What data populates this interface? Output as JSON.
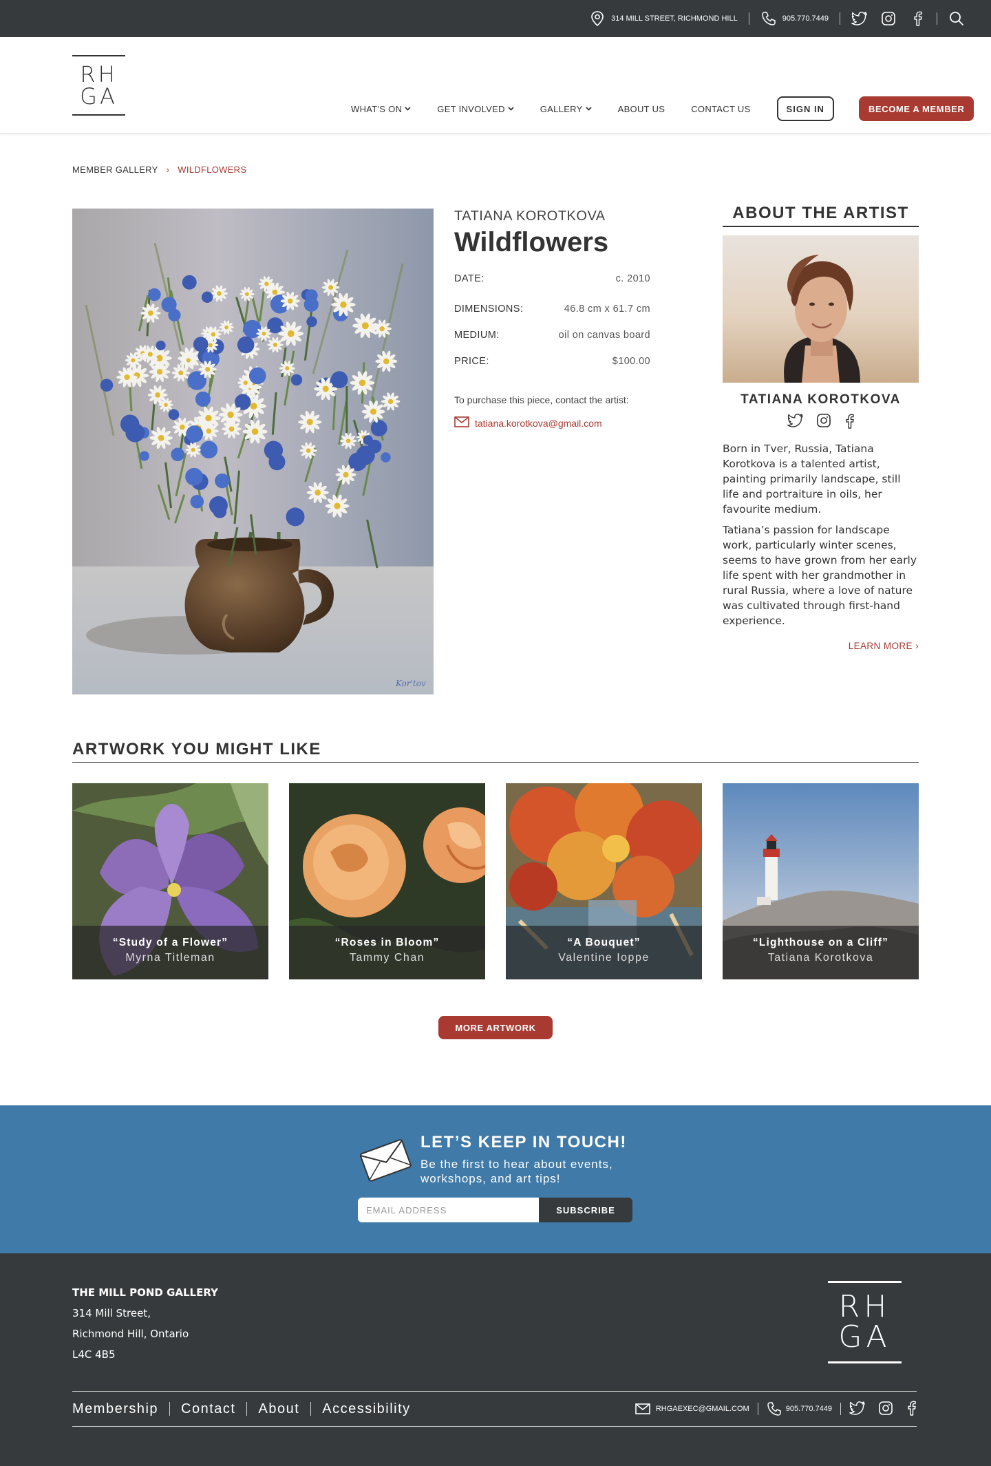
{
  "topbar": {
    "address": "314 MILL STREET, RICHMOND HILL",
    "phone": "905.770.7449"
  },
  "logo": {
    "line1": "RH",
    "line2": "GA"
  },
  "nav": {
    "items": [
      {
        "label": "WHAT'S ON",
        "dropdown": true
      },
      {
        "label": "GET INVOLVED",
        "dropdown": true
      },
      {
        "label": "GALLERY",
        "dropdown": true
      },
      {
        "label": "ABOUT US",
        "dropdown": false
      },
      {
        "label": "CONTACT US",
        "dropdown": false
      }
    ],
    "signin": "SIGN IN",
    "member": "BECOME A MEMBER"
  },
  "breadcrumb": {
    "parent": "MEMBER GALLERY",
    "separator": "›",
    "current": "WILDFLOWERS"
  },
  "artwork": {
    "artist": "TATIANA KOROTKOVA",
    "title": "Wildflowers",
    "details": [
      {
        "label": "DATE:",
        "value": "c. 2010"
      },
      {
        "label": "DIMENSIONS:",
        "value": "46.8 cm x 61.7 cm"
      },
      {
        "label": "MEDIUM:",
        "value": "oil on canvas board"
      },
      {
        "label": "PRICE:",
        "value": "$100.00"
      }
    ],
    "purchase_text": "To purchase this piece, contact the artist:",
    "email": "tatiana.korotkova@gmail.com"
  },
  "about": {
    "heading": "ABOUT THE ARTIST",
    "name": "TATIANA KOROTKOVA",
    "bio": [
      "Born in Tver, Russia, Tatiana Korotkova is a talented artist, painting primarily landscape, still life and portraiture in oils, her favourite medium.",
      "Tatiana’s passion for landscape work, particularly winter scenes, seems to have grown from her early life spent with her grandmother in rural Russia, where a love of nature was cultivated through first-hand experience."
    ],
    "learn_more": "LEARN MORE ›"
  },
  "suggestions": {
    "heading": "ARTWORK YOU MIGHT LIKE",
    "cards": [
      {
        "title": "“Study of a Flower”",
        "artist": "Myrna Titleman"
      },
      {
        "title": "“Roses in Bloom”",
        "artist": "Tammy Chan"
      },
      {
        "title": "“A Bouquet”",
        "artist": "Valentine Ioppe"
      },
      {
        "title": "“Lighthouse on a Cliff”",
        "artist": "Tatiana Korotkova"
      }
    ],
    "more_button": "MORE ARTWORK"
  },
  "newsletter": {
    "title": "LET’S KEEP IN TOUCH!",
    "subtitle": "Be the first to hear about events, workshops, and art tips!",
    "placeholder": "EMAIL ADDRESS",
    "button": "SUBSCRIBE"
  },
  "footer": {
    "name": "THE MILL POND GALLERY",
    "street": "314 Mill Street,",
    "city": "Richmond Hill, Ontario",
    "postal": "L4C 4B5",
    "links": [
      "Membership",
      "Contact",
      "About",
      "Accessibility"
    ],
    "email": "RHGAEXEC@GMAIL.COM",
    "phone": "905.770.7449"
  },
  "colors": {
    "accent": "#a83a32",
    "dark": "#363a3d",
    "newsletter_bg": "#3f7aa8"
  }
}
